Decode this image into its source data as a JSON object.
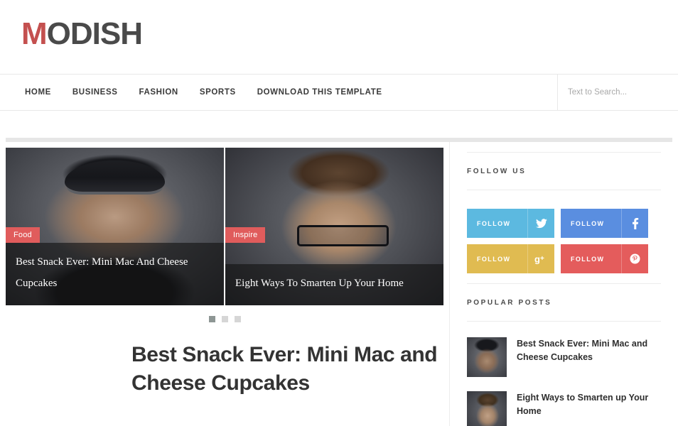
{
  "site": {
    "logo_first": "M",
    "logo_rest": "ODISH"
  },
  "nav": {
    "items": [
      {
        "label": "HOME"
      },
      {
        "label": "BUSINESS"
      },
      {
        "label": "FASHION"
      },
      {
        "label": "SPORTS"
      },
      {
        "label": "DOWNLOAD THIS TEMPLATE"
      }
    ]
  },
  "search": {
    "value": "",
    "placeholder": "Text to Search...",
    "icon": "search-icon"
  },
  "slider": {
    "slides": [
      {
        "badge": "Food",
        "title": "Best Snack Ever: Mini Mac And Cheese Cupcakes",
        "badge_color": "#e05c5c"
      },
      {
        "badge": "Inspire",
        "title": "Eight Ways To Smarten Up Your Home",
        "badge_color": "#e05c5c"
      }
    ],
    "dots": [
      {
        "active": true
      },
      {
        "active": false
      },
      {
        "active": false
      }
    ]
  },
  "feature": {
    "title": "Best Snack Ever: Mini Mac and Cheese Cupcakes"
  },
  "sidebar": {
    "follow_us": {
      "title": "FOLLOW US",
      "buttons": [
        {
          "label": "FOLLOW",
          "network": "twitter",
          "icon": "twitter-icon",
          "glyph": "🐦",
          "color": "#5cb9e0"
        },
        {
          "label": "FOLLOW",
          "network": "facebook",
          "icon": "facebook-icon",
          "glyph": "f",
          "color": "#5a8ee0"
        },
        {
          "label": "FOLLOW",
          "network": "googleplus",
          "icon": "googleplus-icon",
          "glyph": "g+",
          "color": "#e0bb51"
        },
        {
          "label": "FOLLOW",
          "network": "pinterest",
          "icon": "pinterest-icon",
          "glyph": "Ⓟ",
          "color": "#e45c5c"
        }
      ]
    },
    "popular_posts": {
      "title": "POPULAR POSTS",
      "items": [
        {
          "title": "Best Snack Ever: Mini Mac and Cheese Cupcakes"
        },
        {
          "title": "Eight Ways to Smarten up Your Home"
        }
      ]
    }
  }
}
